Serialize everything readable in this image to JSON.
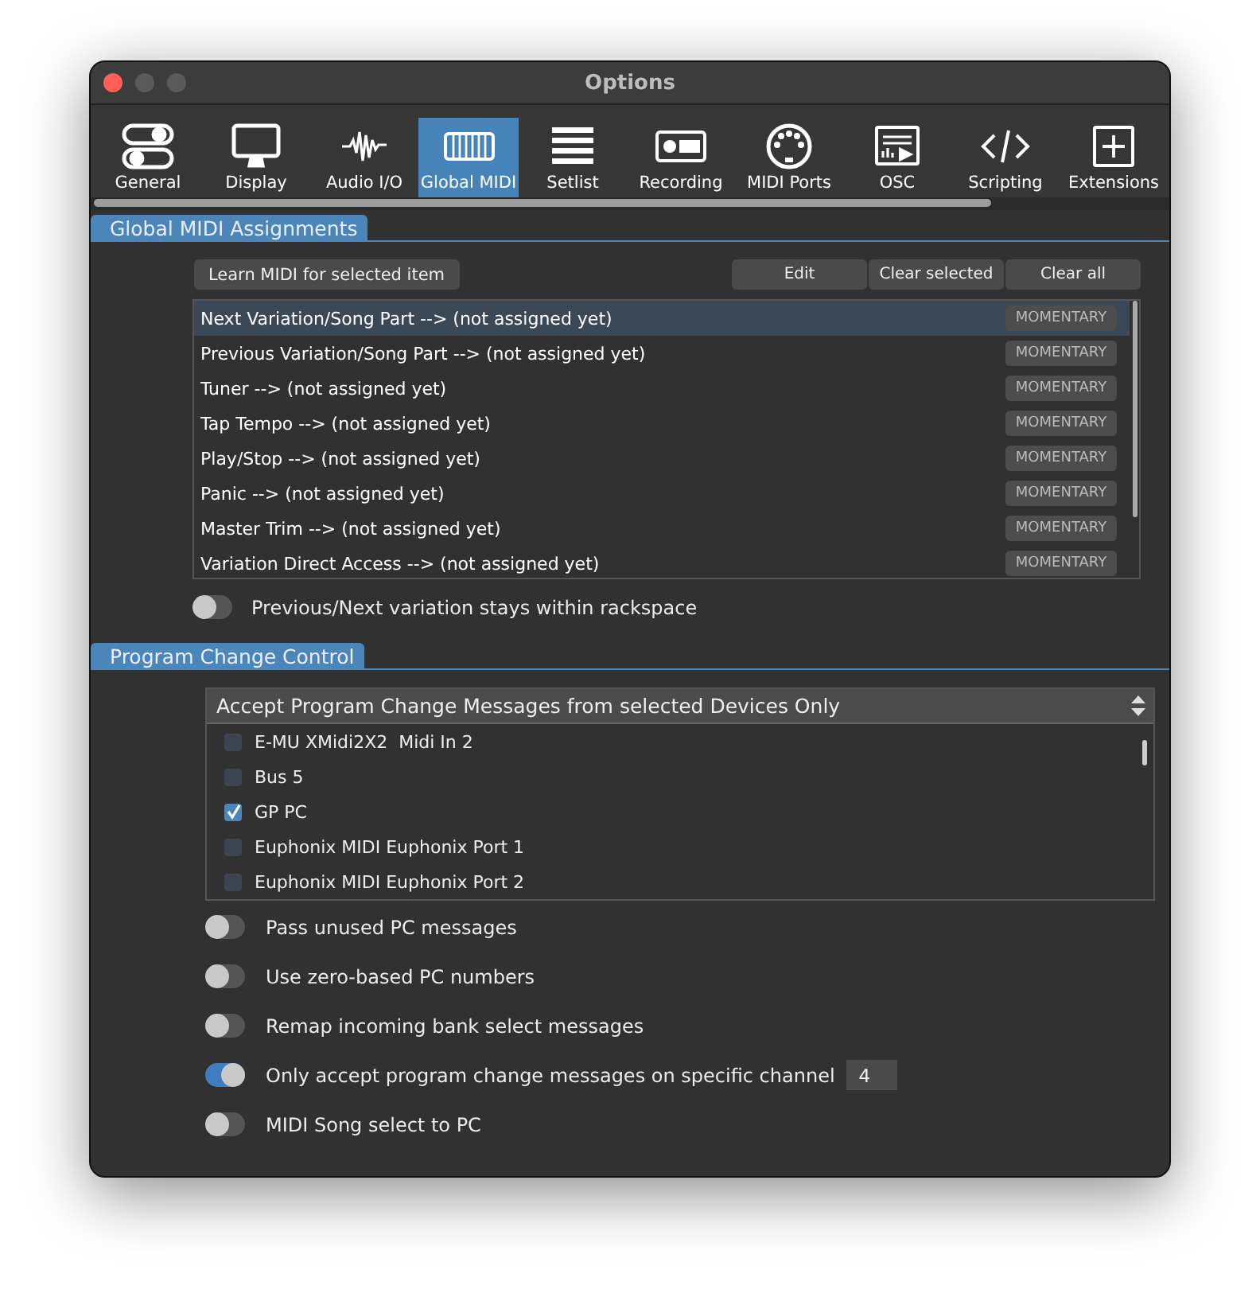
{
  "window": {
    "title": "Options"
  },
  "tabs": [
    {
      "label": "General",
      "selected": false
    },
    {
      "label": "Display",
      "selected": false
    },
    {
      "label": "Audio I/O",
      "selected": false
    },
    {
      "label": "Global MIDI",
      "selected": true
    },
    {
      "label": "Setlist",
      "selected": false
    },
    {
      "label": "Recording",
      "selected": false
    },
    {
      "label": "MIDI Ports",
      "selected": false
    },
    {
      "label": "OSC",
      "selected": false
    },
    {
      "label": "Scripting",
      "selected": false
    },
    {
      "label": "Extensions",
      "selected": false
    }
  ],
  "assignments": {
    "header": "Global MIDI Assignments",
    "learn_button": "Learn MIDI for selected item",
    "buttons": [
      "Edit",
      "Clear selected",
      "Clear all"
    ],
    "rows": [
      {
        "label": "Next Variation/Song Part --> (not assigned yet)",
        "mode": "MOMENTARY",
        "selected": true
      },
      {
        "label": "Previous Variation/Song Part --> (not assigned yet)",
        "mode": "MOMENTARY",
        "selected": false
      },
      {
        "label": "Tuner --> (not assigned yet)",
        "mode": "MOMENTARY",
        "selected": false
      },
      {
        "label": "Tap Tempo --> (not assigned yet)",
        "mode": "MOMENTARY",
        "selected": false
      },
      {
        "label": "Play/Stop --> (not assigned yet)",
        "mode": "MOMENTARY",
        "selected": false
      },
      {
        "label": "Panic --> (not assigned yet)",
        "mode": "MOMENTARY",
        "selected": false
      },
      {
        "label": "Master Trim --> (not assigned yet)",
        "mode": "MOMENTARY",
        "selected": false
      },
      {
        "label": "Variation Direct Access --> (not assigned yet)",
        "mode": "MOMENTARY",
        "selected": false
      }
    ],
    "toggle": {
      "label": "Previous/Next variation stays within rackspace",
      "on": false
    }
  },
  "program_change": {
    "header": "Program Change Control",
    "dropdown": "Accept Program Change Messages from selected Devices Only",
    "devices": [
      {
        "label": "E-MU XMidi2X2  Midi In 2",
        "checked": false
      },
      {
        "label": "Bus 5",
        "checked": false
      },
      {
        "label": "GP PC",
        "checked": true
      },
      {
        "label": "Euphonix MIDI Euphonix Port 1",
        "checked": false
      },
      {
        "label": "Euphonix MIDI Euphonix Port 2",
        "checked": false
      }
    ],
    "toggles": [
      {
        "label": "Pass unused PC messages",
        "on": false
      },
      {
        "label": "Use zero-based PC numbers",
        "on": false
      },
      {
        "label": "Remap incoming bank select messages",
        "on": false
      },
      {
        "label": "Only accept program change messages on specific channel",
        "on": true,
        "channel": "4"
      },
      {
        "label": "MIDI Song select to PC",
        "on": false
      }
    ]
  }
}
